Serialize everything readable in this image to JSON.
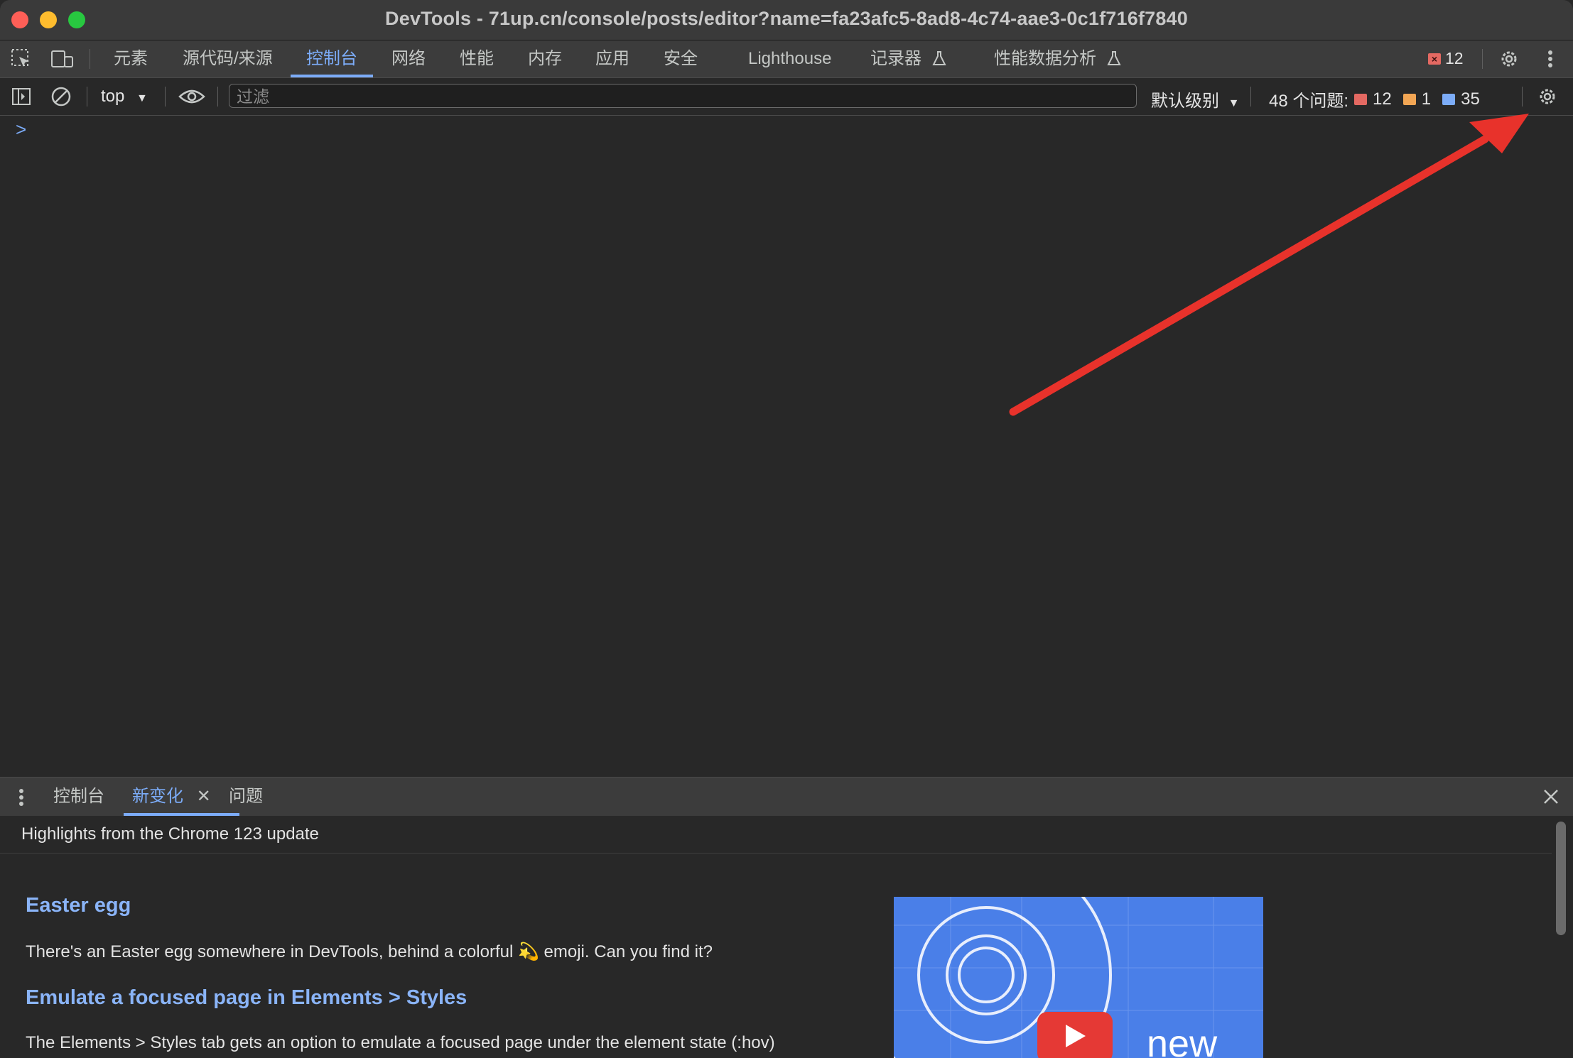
{
  "window": {
    "title": "DevTools - 71up.cn/console/posts/editor?name=fa23afc5-8ad8-4c74-aae3-0c1f716f7840"
  },
  "main_tabs": [
    {
      "label": "元素"
    },
    {
      "label": "源代码/来源"
    },
    {
      "label": "控制台"
    },
    {
      "label": "网络"
    },
    {
      "label": "性能"
    },
    {
      "label": "内存"
    },
    {
      "label": "应用"
    },
    {
      "label": "安全"
    },
    {
      "label": "Lighthouse"
    },
    {
      "label": "记录器"
    },
    {
      "label": "性能数据分析"
    }
  ],
  "active_main_tab": "控制台",
  "tabbar": {
    "error_count": "12"
  },
  "console_toolbar": {
    "context": "top",
    "filter_placeholder": "过滤",
    "level": "默认级别",
    "issues_label": "48 个问题:",
    "issue_errors": "12",
    "issue_warnings": "1",
    "issue_info": "35"
  },
  "console": {
    "prompt": ">"
  },
  "drawer": {
    "tabs": [
      {
        "label": "控制台"
      },
      {
        "label": "新变化"
      },
      {
        "label": "问题"
      }
    ],
    "active_tab": "新变化",
    "highlights_title": "Highlights from the Chrome 123 update",
    "sections": [
      {
        "heading": "Easter egg",
        "text": "There's an Easter egg somewhere in DevTools, behind a colorful 💫 emoji. Can you find it?"
      },
      {
        "heading": "Emulate a focused page in Elements > Styles",
        "text": "The Elements > Styles tab gets an option to emulate a focused page under the element state (:hov)"
      }
    ],
    "video_label": "new"
  },
  "colors": {
    "accent": "#7cacf8",
    "error": "#e46962",
    "warning": "#f2a654",
    "annotation_arrow": "#e8322b"
  }
}
